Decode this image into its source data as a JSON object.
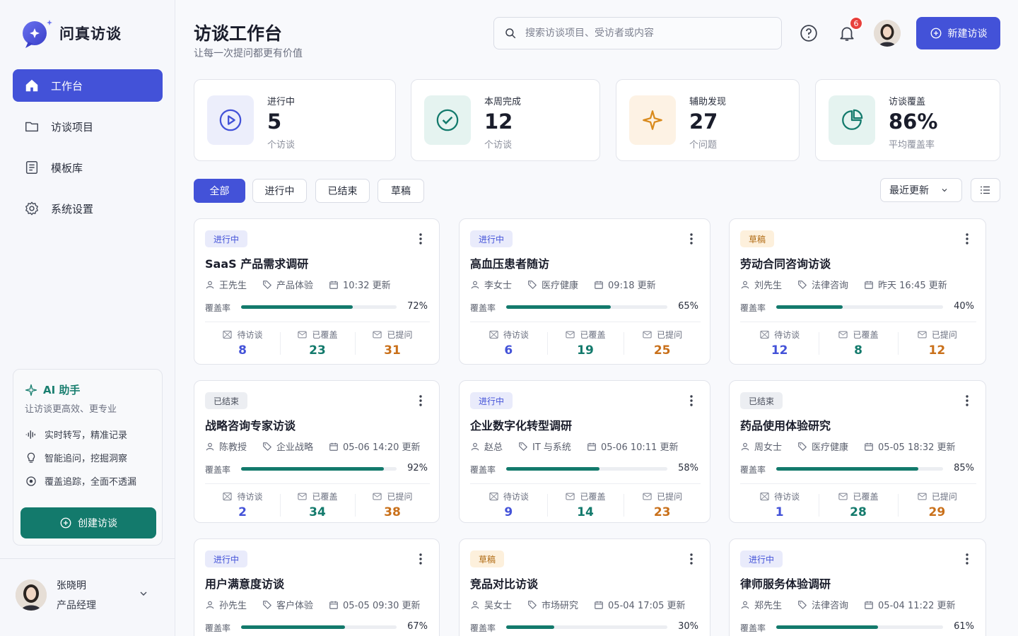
{
  "app": {
    "name": "问真访谈"
  },
  "sidebar": {
    "items": [
      {
        "label": "工作台",
        "icon": "home-icon",
        "active": true
      },
      {
        "label": "访谈项目",
        "icon": "folder-icon",
        "active": false
      },
      {
        "label": "模板库",
        "icon": "document-icon",
        "active": false
      },
      {
        "label": "系统设置",
        "icon": "gear-icon",
        "active": false
      }
    ],
    "ai": {
      "title": "AI 助手",
      "subtitle": "让访谈更高效、更专业",
      "features": [
        "实时转写，精准记录",
        "智能追问，挖掘洞察",
        "覆盖追踪，全面不透漏"
      ],
      "button": "创建访谈"
    },
    "user": {
      "name": "张晓明",
      "role": "产品经理"
    }
  },
  "header": {
    "title": "访谈工作台",
    "subtitle": "让每一次提问都更有价值",
    "search_placeholder": "搜索访谈项目、受访者或内容",
    "notification_count": "6",
    "new_button": "新建访谈"
  },
  "stats": [
    {
      "label": "进行中",
      "value": "5",
      "unit": "个访谈",
      "icon": "play-icon",
      "color": "#4352d8"
    },
    {
      "label": "本周完成",
      "value": "12",
      "unit": "个访谈",
      "icon": "check-circle-icon",
      "color": "#137a6c"
    },
    {
      "label": "辅助发现",
      "value": "27",
      "unit": "个问题",
      "icon": "sparkle-icon",
      "color": "#d98a1c"
    },
    {
      "label": "访谈覆盖",
      "value": "86%",
      "unit": "平均覆盖率",
      "icon": "pie-chart-icon",
      "color": "#137a6c"
    }
  ],
  "filters": [
    "全部",
    "进行中",
    "已结束",
    "草稿"
  ],
  "sort_label": "最近更新",
  "labels": {
    "coverage": "覆盖率",
    "pending": "待访谈",
    "covered": "已覆盖",
    "asked": "已提问"
  },
  "cards": [
    {
      "status": "进行中",
      "status_type": "running",
      "title": "SaaS 产品需求调研",
      "person": "王先生",
      "category": "产品体验",
      "updated": "10:32 更新",
      "coverage": 72,
      "coverage_text": "72%",
      "pending": "8",
      "covered": "23",
      "asked": "31"
    },
    {
      "status": "进行中",
      "status_type": "running",
      "title": "高血压患者随访",
      "person": "李女士",
      "category": "医疗健康",
      "updated": "09:18 更新",
      "coverage": 65,
      "coverage_text": "65%",
      "pending": "6",
      "covered": "19",
      "asked": "25"
    },
    {
      "status": "草稿",
      "status_type": "draft",
      "title": "劳动合同咨询访谈",
      "person": "刘先生",
      "category": "法律咨询",
      "updated": "昨天 16:45 更新",
      "coverage": 40,
      "coverage_text": "40%",
      "pending": "12",
      "covered": "8",
      "asked": "12"
    },
    {
      "status": "已结束",
      "status_type": "done",
      "title": "战略咨询专家访谈",
      "person": "陈教授",
      "category": "企业战略",
      "updated": "05-06 14:20 更新",
      "coverage": 92,
      "coverage_text": "92%",
      "pending": "2",
      "covered": "34",
      "asked": "38"
    },
    {
      "status": "进行中",
      "status_type": "running",
      "title": "企业数字化转型调研",
      "person": "赵总",
      "category": "IT 与系统",
      "updated": "05-06 10:11 更新",
      "coverage": 58,
      "coverage_text": "58%",
      "pending": "9",
      "covered": "14",
      "asked": "23"
    },
    {
      "status": "已结束",
      "status_type": "done",
      "title": "药品使用体验研究",
      "person": "周女士",
      "category": "医疗健康",
      "updated": "05-05 18:32 更新",
      "coverage": 85,
      "coverage_text": "85%",
      "pending": "1",
      "covered": "28",
      "asked": "29"
    },
    {
      "status": "进行中",
      "status_type": "running",
      "title": "用户满意度访谈",
      "person": "孙先生",
      "category": "客户体验",
      "updated": "05-05 09:30 更新",
      "coverage": 67,
      "coverage_text": "67%"
    },
    {
      "status": "草稿",
      "status_type": "draft",
      "title": "竞品对比访谈",
      "person": "吴女士",
      "category": "市场研究",
      "updated": "05-04 17:05 更新",
      "coverage": 30,
      "coverage_text": "30%"
    },
    {
      "status": "进行中",
      "status_type": "running",
      "title": "律师服务体验调研",
      "person": "郑先生",
      "category": "法律咨询",
      "updated": "05-04 11:22 更新",
      "coverage": 61,
      "coverage_text": "61%"
    }
  ]
}
